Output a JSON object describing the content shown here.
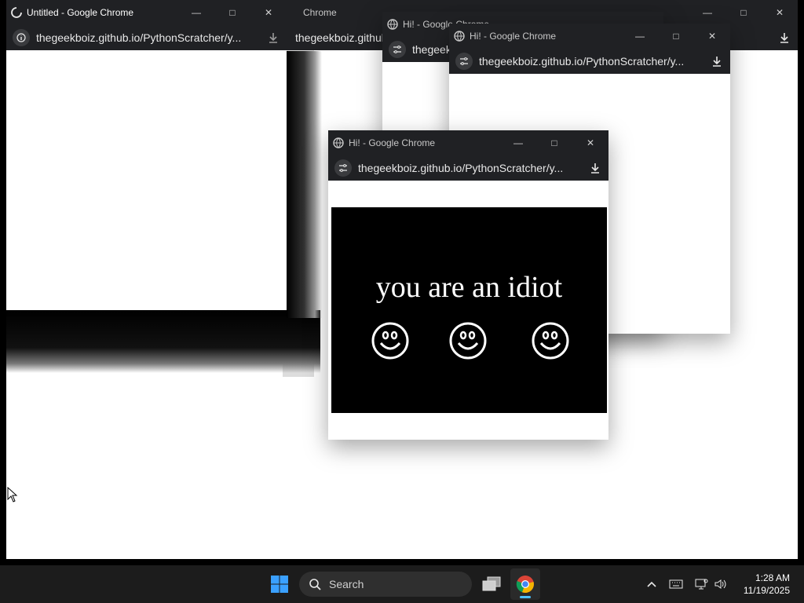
{
  "windows": {
    "back_large": {
      "title": "Chrome",
      "address": "thegeekboiz.github.io/Py"
    },
    "back_mid": {
      "title": "Hi! - Google Chrome",
      "address": "thegeek"
    },
    "back_right": {
      "title": "Hi! - Google Chrome",
      "address": "thegeekboiz.github.io/PythonScratcher/y..."
    },
    "untitled": {
      "title": "Untitled - Google Chrome",
      "address": "thegeekboiz.github.io/PythonScratcher/y..."
    },
    "front": {
      "title": "Hi! - Google Chrome",
      "address": "thegeekboiz.github.io/PythonScratcher/y...",
      "message": "you are an idiot"
    }
  },
  "taskbar": {
    "search_label": "Search",
    "time": "1:28 AM",
    "date": "11/19/2025"
  },
  "colors": {
    "titlebar": "#202124",
    "taskbar": "#1c1c1c",
    "accent": "#0078d4"
  },
  "icons": [
    "globe-icon",
    "info-icon",
    "site-settings-icon",
    "download-icon",
    "minimize-icon",
    "maximize-icon",
    "close-icon",
    "windows-start-icon",
    "search-icon",
    "task-view-icon",
    "chrome-icon",
    "chevron-up-icon",
    "keyboard-icon",
    "network-icon",
    "volume-icon",
    "cursor-icon"
  ]
}
